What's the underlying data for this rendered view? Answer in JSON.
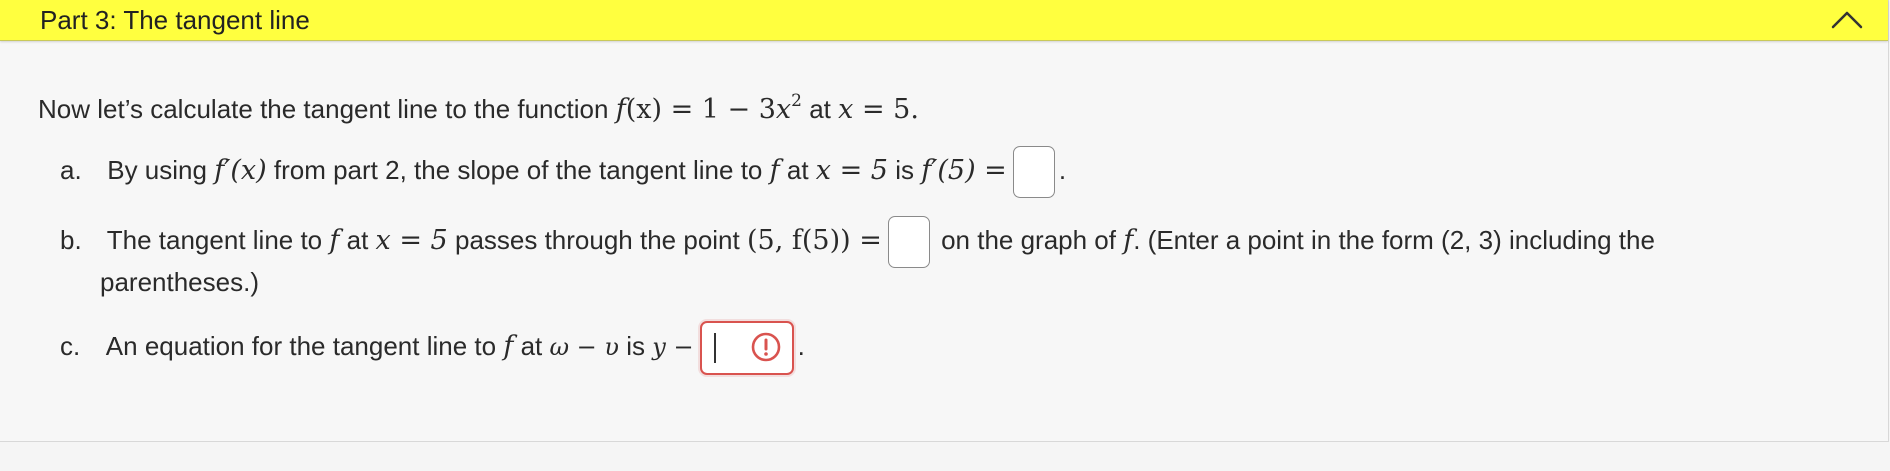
{
  "header": {
    "title": "Part 3: The tangent line"
  },
  "intro": {
    "text_before": "Now let’s calculate the tangent line to the function",
    "function": "f(x) = 1 − 3x",
    "exponent": "2",
    "text_at": "at",
    "point": "x = 5.",
    "lhs_f": "f",
    "lhs_paren": "(x) = 1 − 3",
    "lhs_x": "x",
    "x_eq": " = 5."
  },
  "item_a": {
    "marker": "a.",
    "text_before": "By using",
    "fprime": "f′(x)",
    "text_mid": "from part 2, the slope of the tangent line to",
    "f": "f",
    "text_at": "at",
    "x_eq_5": "x = 5",
    "text_is": "is",
    "fprime5": "f′(5) =",
    "end": "."
  },
  "item_b": {
    "marker": "b.",
    "text_before": "The tangent line to",
    "f": "f",
    "text_at": "at",
    "x_eq_5": "x = 5",
    "text_mid": "passes through the point",
    "point": "(5, f(5)) =",
    "text_after": "on the graph of",
    "f2": "f",
    "text_end": ". (Enter a point in the form (2, 3) including the",
    "line2": "parentheses.)"
  },
  "item_c": {
    "marker": "c.",
    "text_before": "An equation for the tangent line to",
    "f": "f",
    "text_at": "at",
    "garbled_lhs": "ω − υ",
    "text_is": "is",
    "y_eq": "y −",
    "end": "."
  },
  "colors": {
    "header_bg": "#ffff3f",
    "error_border": "#d9534f",
    "panel_bg": "#f7f7f7"
  },
  "icons": {
    "collapse": "chevron-up-icon",
    "warning": "exclamation-circle-icon"
  }
}
